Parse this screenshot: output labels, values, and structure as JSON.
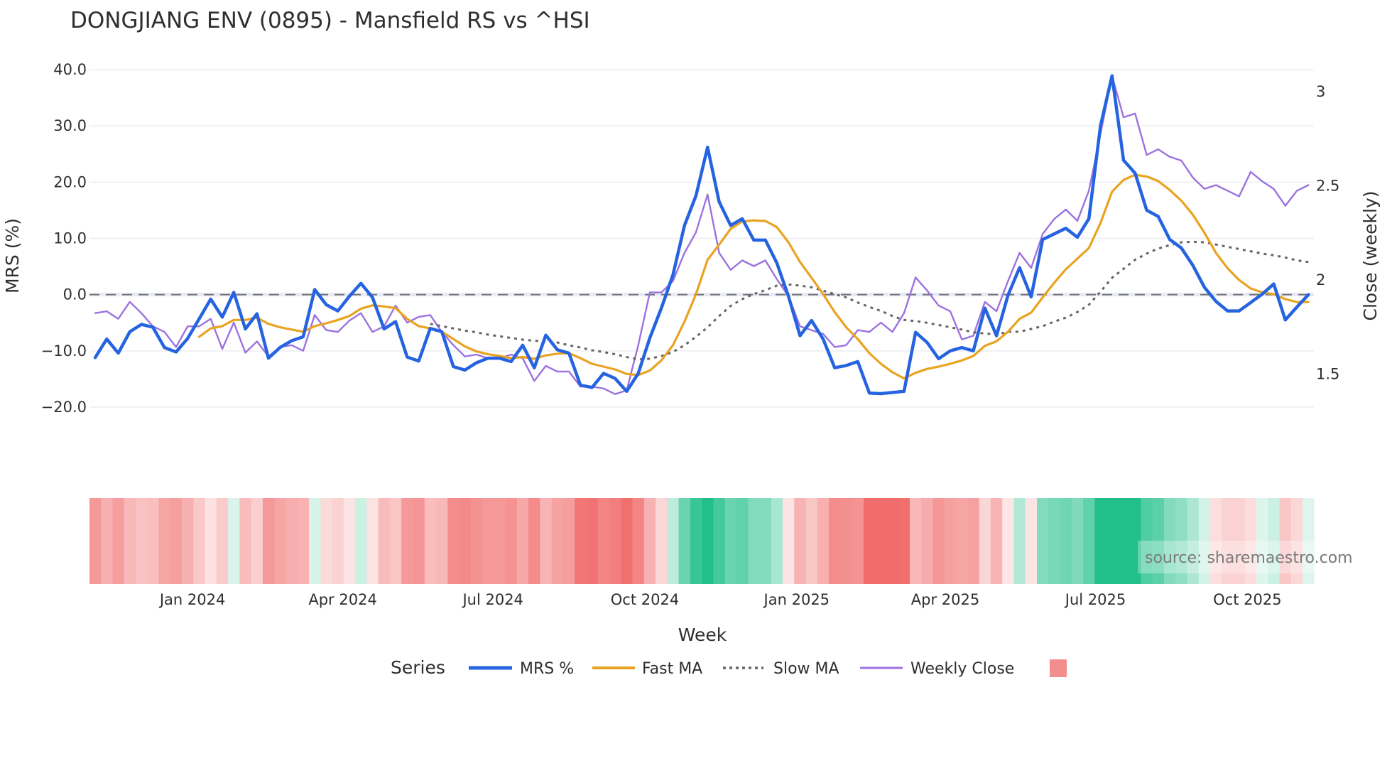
{
  "chart_data": {
    "type": "line",
    "title": "DONGJIANG ENV (0895) - Mansfield RS vs ^HSI",
    "xlabel": "Week",
    "ylabel": "MRS (%)",
    "y2label": "Close (weekly)",
    "x_start": "2023-11-03",
    "x_frequency": "weekly",
    "x_ticks": [
      {
        "date": "2024-01-01",
        "label": "Jan 2024"
      },
      {
        "date": "2024-04-01",
        "label": "Apr 2024"
      },
      {
        "date": "2024-07-01",
        "label": "Jul 2024"
      },
      {
        "date": "2024-10-01",
        "label": "Oct 2024"
      },
      {
        "date": "2025-01-01",
        "label": "Jan 2025"
      },
      {
        "date": "2025-04-01",
        "label": "Apr 2025"
      },
      {
        "date": "2025-07-01",
        "label": "Jul 2025"
      },
      {
        "date": "2025-10-01",
        "label": "Oct 2025"
      }
    ],
    "ylim": [
      -20,
      40
    ],
    "y_ticks": [
      {
        "value": 40,
        "label": "40.0"
      },
      {
        "value": 30,
        "label": "30.0"
      },
      {
        "value": 20,
        "label": "20.0"
      },
      {
        "value": 10,
        "label": "10.0"
      },
      {
        "value": 0,
        "label": "0.0"
      },
      {
        "value": -10,
        "label": "−10.0"
      },
      {
        "value": -20,
        "label": "−20.0"
      }
    ],
    "y2lim": [
      1.321,
      3.113
    ],
    "y2_ticks": [
      {
        "value": 3,
        "label": "3"
      },
      {
        "value": 2.5,
        "label": "2.5"
      },
      {
        "value": 2,
        "label": "2"
      },
      {
        "value": 1.5,
        "label": "1.5"
      }
    ],
    "reference_line": 0,
    "grid": true,
    "legend_title": "Series",
    "legend_position": "bottom-center",
    "series": [
      {
        "name": "MRS %",
        "axis": "y",
        "color": "#2563e0",
        "style": "solid",
        "values": [
          -11.2,
          -7.9,
          -10.4,
          -6.6,
          -5.3,
          -5.8,
          -9.4,
          -10.2,
          -7.8,
          -4.3,
          -0.8,
          -4.0,
          0.4,
          -6.1,
          -3.4,
          -11.3,
          -9.4,
          -8.2,
          -7.5,
          0.9,
          -1.8,
          -2.9,
          -0.3,
          2.0,
          -0.5,
          -6.1,
          -4.8,
          -11.1,
          -11.8,
          -6.0,
          -6.6,
          -12.8,
          -13.4,
          -12.1,
          -11.3,
          -11.3,
          -11.9,
          -9.0,
          -13.0,
          -7.2,
          -9.8,
          -10.4,
          -16.1,
          -16.5,
          -14.0,
          -14.9,
          -17.2,
          -14.0,
          -7.7,
          -2.4,
          3.5,
          12.3,
          17.6,
          26.2,
          16.5,
          12.3,
          13.5,
          9.7,
          9.7,
          5.6,
          -0.3,
          -7.3,
          -4.6,
          -7.9,
          -13.0,
          -12.6,
          -11.9,
          -17.5,
          -17.6,
          -17.4,
          -17.2,
          -6.7,
          -8.5,
          -11.4,
          -10.0,
          -9.4,
          -10.0,
          -2.4,
          -7.3,
          -0.1,
          4.8,
          -0.4,
          9.8,
          10.8,
          11.8,
          10.2,
          13.5,
          30.0,
          38.9,
          23.9,
          21.6,
          15.0,
          13.9,
          9.8,
          8.3,
          5.2,
          1.3,
          -1.2,
          -2.9,
          -2.9,
          -1.4,
          0.1,
          1.9,
          -4.5,
          -2.2,
          0.0
        ]
      },
      {
        "name": "Fast MA",
        "axis": "y",
        "color": "#e9a321",
        "style": "solid",
        "values": [
          null,
          null,
          null,
          null,
          null,
          null,
          null,
          null,
          null,
          -7.5,
          -6.0,
          -5.6,
          -4.5,
          -4.5,
          -4.1,
          -5.2,
          -5.8,
          -6.2,
          -6.6,
          -5.6,
          -5.1,
          -4.5,
          -3.8,
          -2.5,
          -1.9,
          -2.1,
          -2.4,
          -4.3,
          -5.6,
          -6.0,
          -6.6,
          -7.9,
          -9.2,
          -10.1,
          -10.6,
          -10.9,
          -11.3,
          -11.1,
          -11.4,
          -10.8,
          -10.5,
          -10.4,
          -11.3,
          -12.3,
          -12.8,
          -13.3,
          -14.1,
          -14.3,
          -13.5,
          -11.7,
          -9.0,
          -4.8,
          0.1,
          6.2,
          8.9,
          11.7,
          13.0,
          13.2,
          13.1,
          12.0,
          9.3,
          5.8,
          3.0,
          0.1,
          -3.1,
          -5.8,
          -7.9,
          -10.4,
          -12.3,
          -13.8,
          -14.9,
          -13.9,
          -13.2,
          -12.8,
          -12.3,
          -11.7,
          -10.9,
          -9.1,
          -8.3,
          -6.6,
          -4.3,
          -3.2,
          -0.5,
          2.1,
          4.5,
          6.4,
          8.3,
          12.7,
          18.3,
          20.4,
          21.3,
          21.0,
          20.2,
          18.6,
          16.7,
          14.2,
          11.0,
          7.4,
          4.7,
          2.6,
          1.1,
          0.4,
          0.1,
          -0.8,
          -1.3,
          -1.3
        ]
      },
      {
        "name": "Slow MA",
        "axis": "y",
        "color": "#666666",
        "style": "dot",
        "values": [
          null,
          null,
          null,
          null,
          null,
          null,
          null,
          null,
          null,
          null,
          null,
          null,
          null,
          null,
          null,
          null,
          null,
          null,
          null,
          null,
          null,
          null,
          null,
          null,
          null,
          null,
          null,
          null,
          null,
          -5.2,
          -5.6,
          -6.0,
          -6.4,
          -6.7,
          -7.1,
          -7.4,
          -7.7,
          -8.0,
          -8.2,
          -8.3,
          -8.5,
          -9.0,
          -9.4,
          -9.9,
          -10.2,
          -10.6,
          -11.1,
          -11.5,
          -11.4,
          -10.9,
          -10.2,
          -9.0,
          -7.5,
          -5.8,
          -3.8,
          -2.0,
          -0.8,
          0.1,
          0.8,
          1.6,
          1.8,
          1.6,
          1.3,
          0.7,
          0.1,
          -0.5,
          -1.4,
          -2.2,
          -2.9,
          -3.8,
          -4.5,
          -4.7,
          -5.0,
          -5.4,
          -5.8,
          -6.2,
          -6.7,
          -6.9,
          -7.1,
          -6.6,
          -6.6,
          -6.1,
          -5.6,
          -4.8,
          -4.1,
          -3.1,
          -1.8,
          0.5,
          3.0,
          4.6,
          6.2,
          7.3,
          8.2,
          8.8,
          9.3,
          9.4,
          9.3,
          8.9,
          8.5,
          8.1,
          7.7,
          7.3,
          7.0,
          6.6,
          6.1,
          5.8
        ]
      },
      {
        "name": "Weekly Close",
        "axis": "y2",
        "color": "#9b72e0",
        "style": "solid",
        "values": [
          1.82,
          1.83,
          1.79,
          1.88,
          1.82,
          1.75,
          1.72,
          1.64,
          1.75,
          1.75,
          1.79,
          1.63,
          1.77,
          1.61,
          1.67,
          1.59,
          1.64,
          1.65,
          1.62,
          1.81,
          1.73,
          1.72,
          1.78,
          1.82,
          1.72,
          1.75,
          1.86,
          1.77,
          1.8,
          1.81,
          1.72,
          1.65,
          1.59,
          1.6,
          1.58,
          1.58,
          1.6,
          1.58,
          1.46,
          1.54,
          1.51,
          1.51,
          1.43,
          1.43,
          1.42,
          1.39,
          1.41,
          1.65,
          1.93,
          1.93,
          1.99,
          2.14,
          2.25,
          2.45,
          2.14,
          2.05,
          2.1,
          2.07,
          2.1,
          2.0,
          1.91,
          1.75,
          1.73,
          1.71,
          1.64,
          1.65,
          1.73,
          1.72,
          1.77,
          1.72,
          1.82,
          2.01,
          1.94,
          1.86,
          1.83,
          1.68,
          1.7,
          1.88,
          1.83,
          1.99,
          2.14,
          2.06,
          2.24,
          2.32,
          2.37,
          2.31,
          2.47,
          2.77,
          3.08,
          2.86,
          2.88,
          2.66,
          2.69,
          2.65,
          2.63,
          2.54,
          2.48,
          2.5,
          2.47,
          2.44,
          2.57,
          2.52,
          2.48,
          2.39,
          2.47,
          2.5
        ]
      }
    ],
    "heatmap": {
      "source_series": "MRS %",
      "zrange": [
        -20,
        20
      ],
      "low_color": "#ef5b5b",
      "mid_color": "#ffffff",
      "high_color": "#22bf8b",
      "legend_swatch_color": "#f28e8e"
    }
  },
  "watermark": "source: sharemaestro.com"
}
